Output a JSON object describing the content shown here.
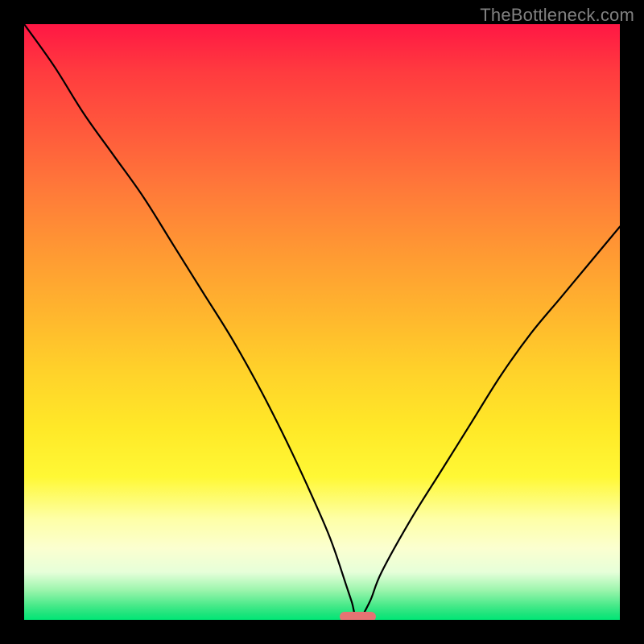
{
  "watermark": "TheBottleneck.com",
  "chart_data": {
    "type": "line",
    "title": "",
    "xlabel": "",
    "ylabel": "",
    "xlim": [
      0,
      100
    ],
    "ylim": [
      0,
      100
    ],
    "grid": false,
    "legend": false,
    "series": [
      {
        "name": "bottleneck-curve",
        "x": [
          0,
          5,
          10,
          15,
          20,
          25,
          30,
          35,
          40,
          45,
          50,
          52,
          54,
          55,
          56,
          58,
          60,
          65,
          70,
          75,
          80,
          85,
          90,
          95,
          100
        ],
        "y": [
          100,
          93,
          85,
          78,
          71,
          63,
          55,
          47,
          38,
          28,
          17,
          12,
          6,
          3,
          0,
          3,
          8,
          17,
          25,
          33,
          41,
          48,
          54,
          60,
          66
        ]
      }
    ],
    "marker": {
      "x_center": 56,
      "width_pct": 6,
      "color": "#e57373"
    },
    "colors": {
      "curve": "#000000",
      "gradient_top": "#ff1744",
      "gradient_bottom": "#00e676",
      "background": "#000000"
    }
  }
}
